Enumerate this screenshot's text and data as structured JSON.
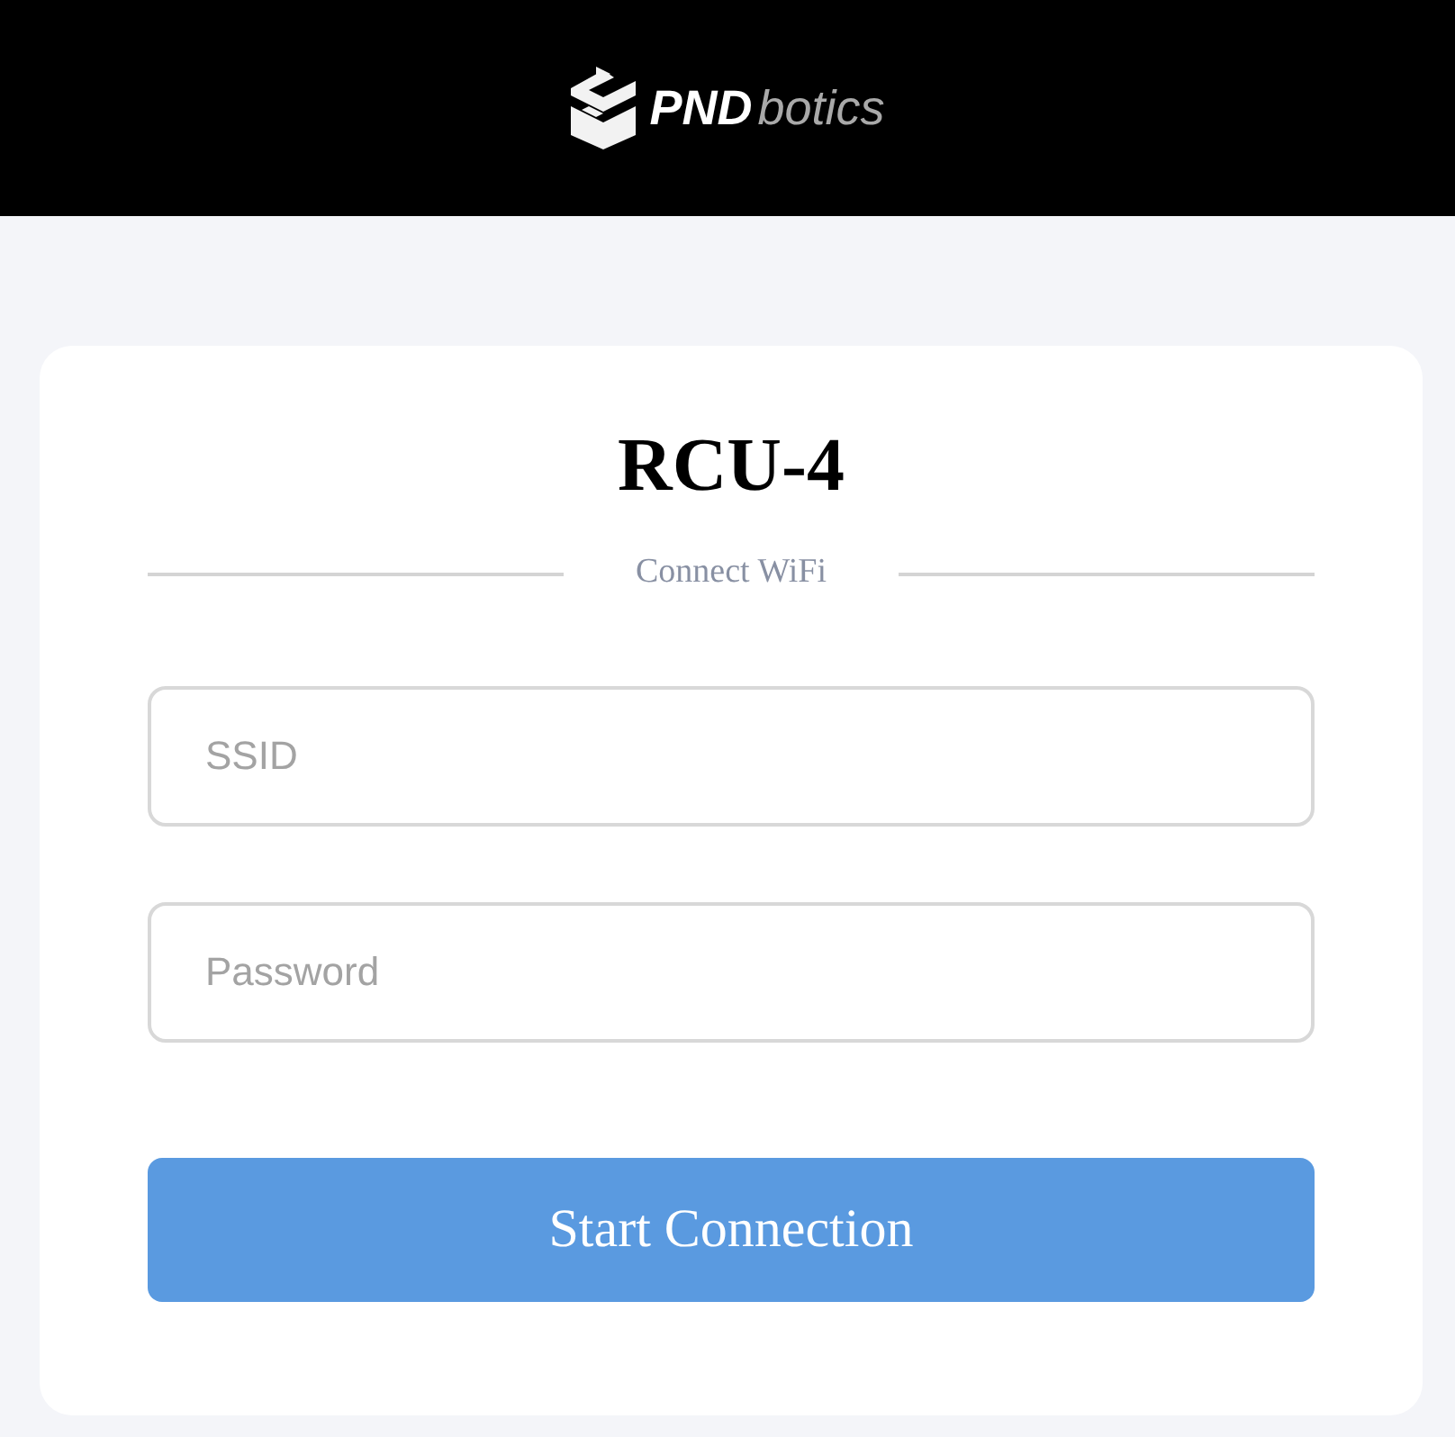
{
  "header": {
    "logo": {
      "brand_bold": "PND",
      "brand_light": "botics"
    }
  },
  "card": {
    "title": "RCU-4",
    "subtitle": "Connect WiFi",
    "fields": [
      {
        "placeholder": "SSID"
      },
      {
        "placeholder": "Password"
      }
    ],
    "button": "Start Connection"
  }
}
